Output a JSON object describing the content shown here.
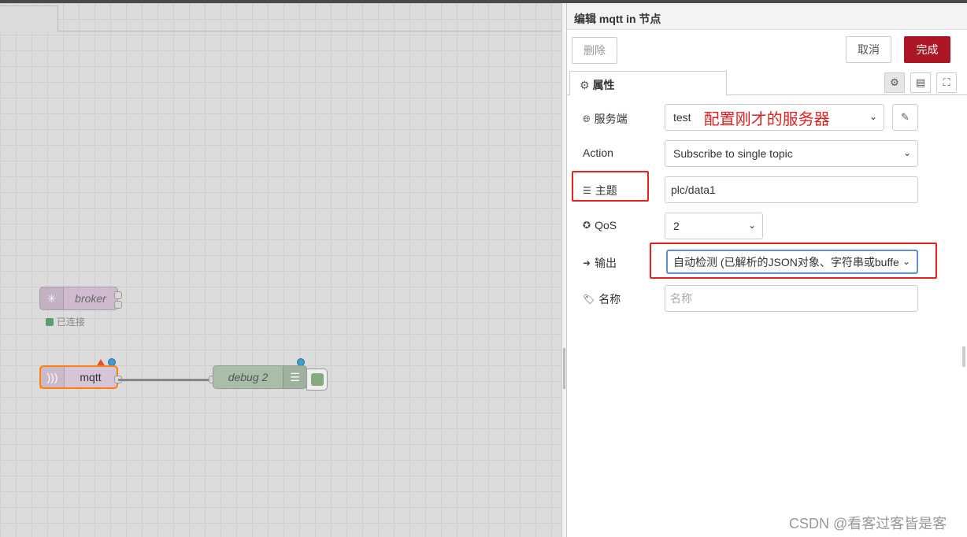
{
  "workspace": {
    "nodes": {
      "broker": {
        "label": "broker",
        "status": "已连接"
      },
      "mqtt": {
        "label": "mqtt"
      },
      "debug": {
        "label": "debug 2"
      }
    }
  },
  "editor": {
    "title": "编辑 mqtt in 节点",
    "buttons": {
      "delete": "删除",
      "cancel": "取消",
      "done": "完成"
    },
    "tab_properties": "属性",
    "fields": {
      "server": {
        "label": "服务端",
        "value": "test",
        "annotation": "配置刚才的服务器"
      },
      "action": {
        "label": "Action",
        "value": "Subscribe to single topic"
      },
      "topic": {
        "label": "主题",
        "value": "plc/data1"
      },
      "qos": {
        "label": "QoS",
        "value": "2"
      },
      "output": {
        "label": "输出",
        "value": "自动检测 (已解析的JSON对象、字符串或buffe"
      },
      "name": {
        "label": "名称",
        "placeholder": "名称"
      }
    }
  },
  "watermark": "CSDN @看客过客皆是客",
  "colors": {
    "done_button": "#ad1625",
    "highlight_box": "#e8231c",
    "annotation_text": "#e02020"
  }
}
